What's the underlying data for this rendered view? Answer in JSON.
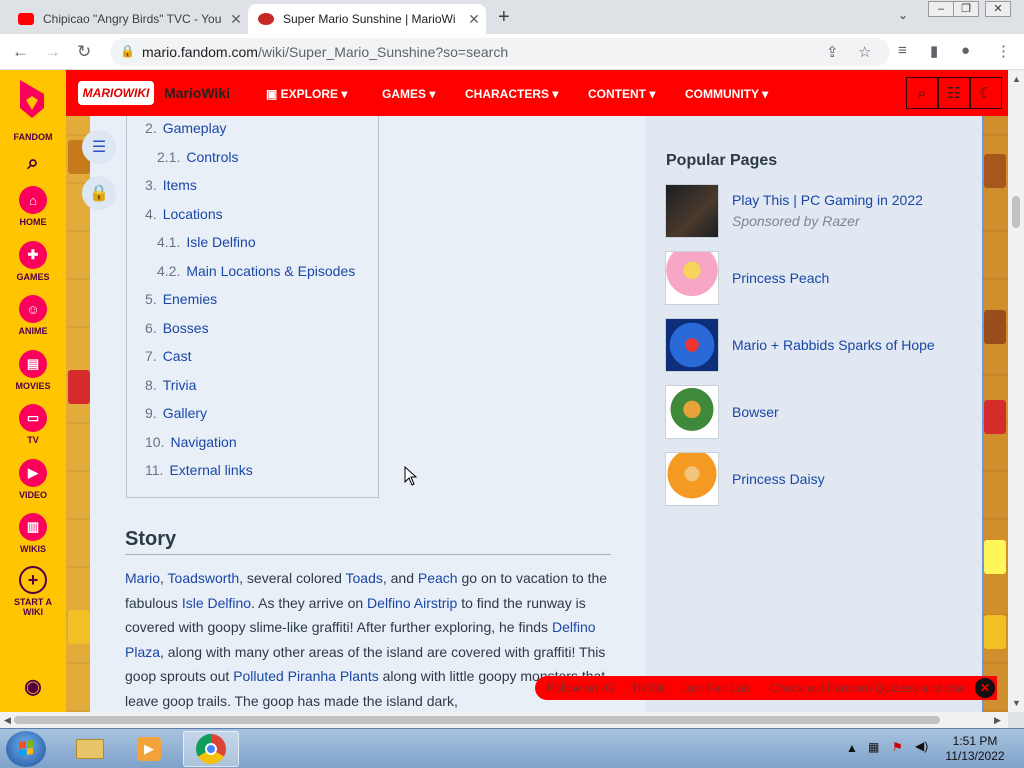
{
  "browser": {
    "tabs": [
      {
        "title": "Chipicao \"Angry Birds\" TVC - You",
        "favicon_color": "#ff0000"
      },
      {
        "title": "Super Mario Sunshine | MarioWi",
        "favicon_color": "#c62828"
      }
    ],
    "new_tab": "+",
    "url_host": "mario.fandom.com",
    "url_path": "/wiki/Super_Mario_Sunshine?so=search"
  },
  "fandom_sidebar": {
    "brand": "FANDOM",
    "items": [
      "HOME",
      "GAMES",
      "ANIME",
      "MOVIES",
      "TV",
      "VIDEO",
      "WIKIS",
      "START A WIKI"
    ]
  },
  "wiki_header": {
    "logo_text": "MARIOWIKI",
    "name": "MarioWiki",
    "nav": [
      "EXPLORE",
      "GAMES",
      "CHARACTERS",
      "CONTENT",
      "COMMUNITY"
    ]
  },
  "toc": [
    {
      "num": "2.",
      "label": "Gameplay",
      "sub": false
    },
    {
      "num": "2.1.",
      "label": "Controls",
      "sub": true
    },
    {
      "num": "3.",
      "label": "Items",
      "sub": false
    },
    {
      "num": "4.",
      "label": "Locations",
      "sub": false
    },
    {
      "num": "4.1.",
      "label": "Isle Delfino",
      "sub": true
    },
    {
      "num": "4.2.",
      "label": "Main Locations & Episodes",
      "sub": true
    },
    {
      "num": "5.",
      "label": "Enemies",
      "sub": false
    },
    {
      "num": "6.",
      "label": "Bosses",
      "sub": false
    },
    {
      "num": "7.",
      "label": "Cast",
      "sub": false
    },
    {
      "num": "8.",
      "label": "Trivia",
      "sub": false
    },
    {
      "num": "9.",
      "label": "Gallery",
      "sub": false
    },
    {
      "num": "10.",
      "label": "Navigation",
      "sub": false
    },
    {
      "num": "11.",
      "label": "External links",
      "sub": false
    }
  ],
  "story": {
    "heading": "Story",
    "segments": [
      {
        "t": "Mario",
        "link": true
      },
      {
        "t": ", ",
        "link": false
      },
      {
        "t": "Toadsworth",
        "link": true
      },
      {
        "t": ", several colored ",
        "link": false
      },
      {
        "t": "Toads",
        "link": true
      },
      {
        "t": ", and ",
        "link": false
      },
      {
        "t": "Peach",
        "link": true
      },
      {
        "t": " go on to vacation to the fabulous ",
        "link": false
      },
      {
        "t": "Isle Delfino",
        "link": true
      },
      {
        "t": ". As they arrive on ",
        "link": false
      },
      {
        "t": "Delfino Airstrip",
        "link": true
      },
      {
        "t": " to find the runway is covered with goopy slime-like graffiti! After further exploring, he finds ",
        "link": false
      },
      {
        "t": "Delfino Plaza",
        "link": true
      },
      {
        "t": ", along with many other areas of the island are covered with graffiti! This goop sprouts out ",
        "link": false
      },
      {
        "t": "Polluted Piranha Plants",
        "link": true
      },
      {
        "t": " along with little goopy monsters that leave goop trails. The goop has made the island dark,",
        "link": false
      }
    ]
  },
  "popular_pages": {
    "title": "Popular Pages",
    "items": [
      {
        "label": "Play This | PC Gaming in 2022",
        "sub": "Sponsored by Razer"
      },
      {
        "label": "Princess Peach",
        "sub": ""
      },
      {
        "label": "Mario + Rabbids Sparks of Hope",
        "sub": ""
      },
      {
        "label": "Bowser",
        "sub": ""
      },
      {
        "label": "Princess Daisy",
        "sub": ""
      }
    ]
  },
  "follow_bar": [
    "Follow on IG",
    "TikTok",
    "Join Fan Lab",
    "Check out Fandom Quizzes and cha"
  ],
  "taskbar": {
    "time": "1:51 PM",
    "date": "11/13/2022"
  },
  "colors": {
    "fandom_yellow": "#ffc500",
    "fandom_pink": "#fa005a",
    "wiki_red": "#ff0000",
    "link_blue": "#1a47a6"
  }
}
